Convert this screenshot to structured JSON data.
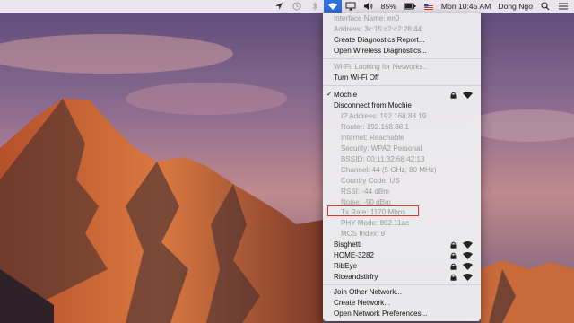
{
  "menubar": {
    "battery_percent": "85%",
    "clock": "Mon 10:45 AM",
    "user": "Dong Ngo",
    "icons": [
      "location-icon",
      "time-machine-icon",
      "bluetooth-icon",
      "wifi-icon",
      "airplay-icon",
      "volume-icon",
      "battery-icon",
      "flag-icon",
      "search-icon",
      "control-menu-icon"
    ]
  },
  "wifi_menu": {
    "header": [
      {
        "label": "Interface Name: en0",
        "enabled": false
      },
      {
        "label": "Address: 3c:15:c2:c2:28:44",
        "enabled": false
      },
      {
        "label": "Create Diagnostics Report...",
        "enabled": true
      },
      {
        "label": "Open Wireless Diagnostics...",
        "enabled": true
      }
    ],
    "status": {
      "label": "Wi-Fi: Looking for Networks...",
      "enabled": false
    },
    "toggle": {
      "label": "Turn Wi-Fi Off",
      "enabled": true
    },
    "current_network": {
      "name": "Mochie",
      "disconnect": "Disconnect from Mochie",
      "details": [
        "IP Address: 192.168.88.19",
        "Router: 192.168.88.1",
        "Internet: Reachable",
        "Security: WPA2 Personal",
        "BSSID: 00:11:32:68:42:13",
        "Channel: 44 (5 GHz, 80 MHz)",
        "Country Code: US",
        "RSSI: -44 dBm",
        "Noise: -90 dBm",
        "Tx Rate: 1170 Mbps",
        "PHY Mode: 802.11ac",
        "MCS Index: 9"
      ]
    },
    "networks": [
      "Bisghetti",
      "HOME-3282",
      "RibEye",
      "Riceandstirfry"
    ],
    "footer": [
      "Join Other Network...",
      "Create Network...",
      "Open Network Preferences..."
    ]
  },
  "colors": {
    "highlight": "#2f6fe0",
    "annotation_box": "#e23232"
  }
}
